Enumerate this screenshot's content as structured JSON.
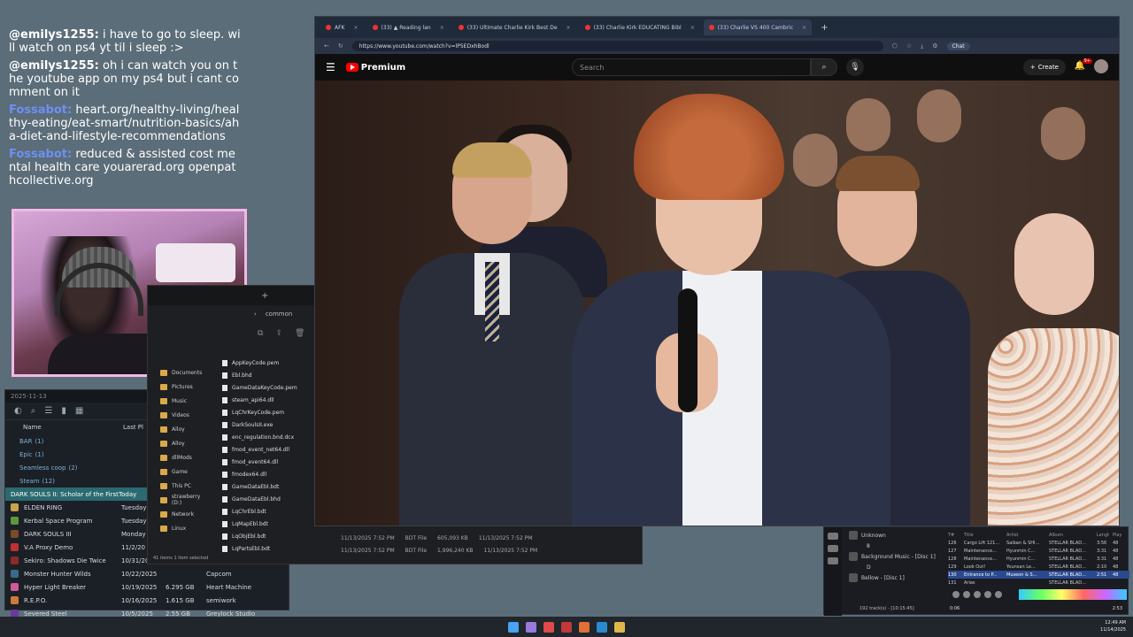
{
  "chat": [
    {
      "user": "@emilys1255:",
      "color": "#ffffff",
      "text": "i have to go to sleep. will watch on ps4 yt til i sleep :>"
    },
    {
      "user": "@emilys1255:",
      "color": "#ffffff",
      "text": "oh i can watch you on the youtube app on my ps4 but i cant comment on it"
    },
    {
      "user": "Fossabot:",
      "color": "#6f8ff5",
      "text": "heart.org/healthy-living/healthy-eating/eat-smart/nutrition-basics/aha-diet-and-lifestyle-recommendations"
    },
    {
      "user": "Fossabot:",
      "color": "#6f8ff5",
      "text": "reduced & assisted cost mental health care youarerad.org openpathcollective.org"
    }
  ],
  "library": {
    "column_name": "Name",
    "column_last": "Last Pl",
    "groups": [
      {
        "label": "BAR",
        "count": "(1)"
      },
      {
        "label": "Epic",
        "count": "(1)"
      },
      {
        "label": "Seamless coop",
        "count": "(2)"
      },
      {
        "label": "Steam",
        "count": "(12)"
      }
    ],
    "selected": {
      "name": "DARK SOULS II: Scholar of the First Sin",
      "date": "Today"
    },
    "rows": [
      {
        "name": "ELDEN RING",
        "date": "Tuesday",
        "size": "",
        "publisher": "",
        "color": "#c9a24a"
      },
      {
        "name": "Kerbal Space Program",
        "date": "Tuesday",
        "size": "",
        "publisher": "",
        "color": "#5a9a3a"
      },
      {
        "name": "DARK SOULS III",
        "date": "Monday",
        "size": "",
        "publisher": "",
        "color": "#7a4a2a"
      },
      {
        "name": "V.A Proxy Demo",
        "date": "11/2/20",
        "size": "",
        "publisher": "",
        "color": "#c03030"
      },
      {
        "name": "Sekiro: Shadows Die Twice",
        "date": "10/31/20",
        "size": "",
        "publisher": "",
        "color": "#8a2a2a"
      },
      {
        "name": "Monster Hunter Wilds",
        "date": "10/22/2025",
        "size": "",
        "publisher": "Capcom",
        "color": "#3a6a8a"
      },
      {
        "name": "Hyper Light Breaker",
        "date": "10/19/2025",
        "size": "6.295 GB",
        "publisher": "Heart Machine",
        "color": "#d05a9a"
      },
      {
        "name": "R.E.P.O.",
        "date": "10/16/2025",
        "size": "1.615 GB",
        "publisher": "semiwork",
        "color": "#d07a3a"
      },
      {
        "name": "Severed Steel",
        "date": "10/5/2025",
        "size": "2.55 GB",
        "publisher": "Greylock Studio",
        "color": "#6a3a9a"
      }
    ],
    "title_date": "2025-11-13"
  },
  "explorer": {
    "tab_add": "+",
    "breadcrumb": "common",
    "nav": [
      "Documents",
      "Pictures",
      "Music",
      "Videos",
      "Alloy",
      "Alloy",
      "dllMods",
      "Game",
      "This PC",
      "strawberry (D:)",
      "Network",
      "Linux"
    ],
    "files": [
      "AppKeyCode.pem",
      "Ebl.bhd",
      "GameDataKeyCode.pem",
      "steam_api64.dll",
      "LqChrKeyCode.pem",
      "DarkSoulsII.exe",
      "enc_regulation.bnd.dcx",
      "fmod_event_net64.dll",
      "fmod_event64.dll",
      "fmodex64.dll",
      "GameDataEbl.bdt",
      "GameDataEbl.bhd",
      "LqChrEbl.bdt",
      "LqMapEbl.bdt",
      "LqObjEbl.bdt",
      "LqPartsEbl.bdt"
    ],
    "status": "41 items   1 item selected",
    "details": [
      {
        "date": "11/13/2025 7:52 PM",
        "type": "BDT File",
        "size": "605,093 KB",
        "date2": "11/13/2025 7:52 PM"
      },
      {
        "date": "11/13/2025 7:52 PM",
        "type": "BDT File",
        "size": "1,996,240 KB",
        "date2": "11/13/2025 7:52 PM"
      }
    ]
  },
  "browser": {
    "tabs": [
      {
        "label": "AFK",
        "active": false
      },
      {
        "label": "(33) ▲ Reading lan",
        "active": false
      },
      {
        "label": "(33) Ultimate Charlie Kirk Best De",
        "active": false
      },
      {
        "label": "(33) Charlie Kirk EDUCATING Bibl",
        "active": false
      },
      {
        "label": "(33) Charlie VS 400 Cambric",
        "active": true
      }
    ],
    "new_tab": "+",
    "url": "https://www.youtube.com/watch?v=lP5EDxhBodl",
    "chat_button": "Chat"
  },
  "youtube": {
    "logo": "Premium",
    "search_placeholder": "Search",
    "create_label": "Create",
    "notif_badge": "9+"
  },
  "player": {
    "list": [
      "Unknown",
      "Background Music - [Disc 1]",
      "Bellow - [Disc 1]"
    ],
    "list_sub": [
      "8",
      "D"
    ],
    "headers": [
      "T#",
      "Title",
      "Artist",
      "Album",
      "Length",
      "Play"
    ],
    "tracks": [
      {
        "n": "126",
        "title": "Cargo Lift 121...",
        "artist": "Saiban & SHI...",
        "album": "STELLAR BLAD...",
        "len": "3:56",
        "plays": "48"
      },
      {
        "n": "127",
        "title": "Maintenance...",
        "artist": "Hyunmin C...",
        "album": "STELLAR BLAD...",
        "len": "3:31",
        "plays": "48"
      },
      {
        "n": "128",
        "title": "Maintenance...",
        "artist": "Hyunmin C...",
        "album": "STELLAR BLAD...",
        "len": "3:31",
        "plays": "48"
      },
      {
        "n": "129",
        "title": "Look Out!",
        "artist": "Younsan Le...",
        "album": "STELLAR BLAD...",
        "len": "2:10",
        "plays": "48"
      },
      {
        "n": "130",
        "title": "Entrance to P...",
        "artist": "Museon & S...",
        "album": "STELLAR BLAD...",
        "len": "2:51",
        "plays": "48"
      },
      {
        "n": "131",
        "title": "Arias",
        "artist": "",
        "album": "STELLAR BLAD...",
        "len": "",
        "plays": ""
      }
    ],
    "status": "192 track(s) - [10:15:45]",
    "time_left": "0:06",
    "time_right": "2:53"
  },
  "clock": {
    "time": "12:49 AM",
    "date": "11/14/2025"
  }
}
